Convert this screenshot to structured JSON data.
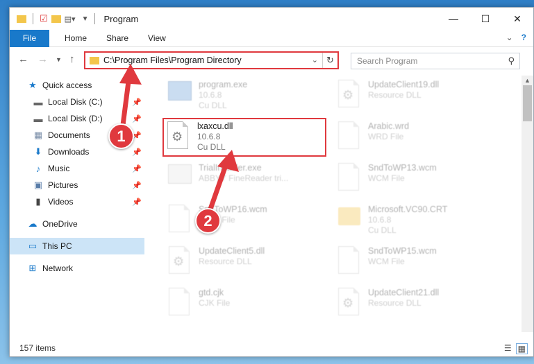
{
  "window": {
    "title": "Program",
    "minimize": "—",
    "maximize": "☐",
    "close": "✕"
  },
  "ribbon": {
    "file": "File",
    "home": "Home",
    "share": "Share",
    "view": "View"
  },
  "address": {
    "path": "C:\\Program Files\\Program Directory",
    "search_placeholder": "Search Program"
  },
  "sidebar": {
    "items": [
      {
        "label": "Quick access",
        "icon": "star-icon"
      },
      {
        "label": "Local Disk (C:)",
        "icon": "drive-icon"
      },
      {
        "label": "Local Disk (D:)",
        "icon": "drive-icon"
      },
      {
        "label": "Documents",
        "icon": "documents-icon"
      },
      {
        "label": "Downloads",
        "icon": "download-icon"
      },
      {
        "label": "Music",
        "icon": "music-icon"
      },
      {
        "label": "Pictures",
        "icon": "pictures-icon"
      },
      {
        "label": "Videos",
        "icon": "videos-icon"
      },
      {
        "label": "OneDrive",
        "icon": "cloud-icon"
      },
      {
        "label": "This PC",
        "icon": "computer-icon"
      },
      {
        "label": "Network",
        "icon": "network-icon"
      }
    ]
  },
  "files": [
    {
      "name": "program.exe",
      "line2": "10.6.8",
      "line3": "Cu DLL"
    },
    {
      "name": "UpdateClient19.dll",
      "line2": "Resource DLL",
      "line3": ""
    },
    {
      "name": "lxaxcu.dll",
      "line2": "10.6.8",
      "line3": "Cu DLL"
    },
    {
      "name": "Arabic.wrd",
      "line2": "WRD File",
      "line3": ""
    },
    {
      "name": "TrialInstaller.exe",
      "line2": "ABBYY FineReader tri...",
      "line3": ""
    },
    {
      "name": "SndToWP13.wcm",
      "line2": "WCM File",
      "line3": ""
    },
    {
      "name": "SndToWP16.wcm",
      "line2": "WCM File",
      "line3": ""
    },
    {
      "name": "Microsoft.VC90.CRT",
      "line2": "10.6.8",
      "line3": "Cu DLL"
    },
    {
      "name": "UpdateClient5.dll",
      "line2": "Resource DLL",
      "line3": ""
    },
    {
      "name": "SndToWP15.wcm",
      "line2": "WCM File",
      "line3": ""
    },
    {
      "name": "gtd.cjk",
      "line2": "CJK File",
      "line3": ""
    },
    {
      "name": "UpdateClient21.dll",
      "line2": "Resource DLL",
      "line3": ""
    }
  ],
  "status": {
    "count": "157 items"
  },
  "callouts": {
    "one": "1",
    "two": "2"
  }
}
